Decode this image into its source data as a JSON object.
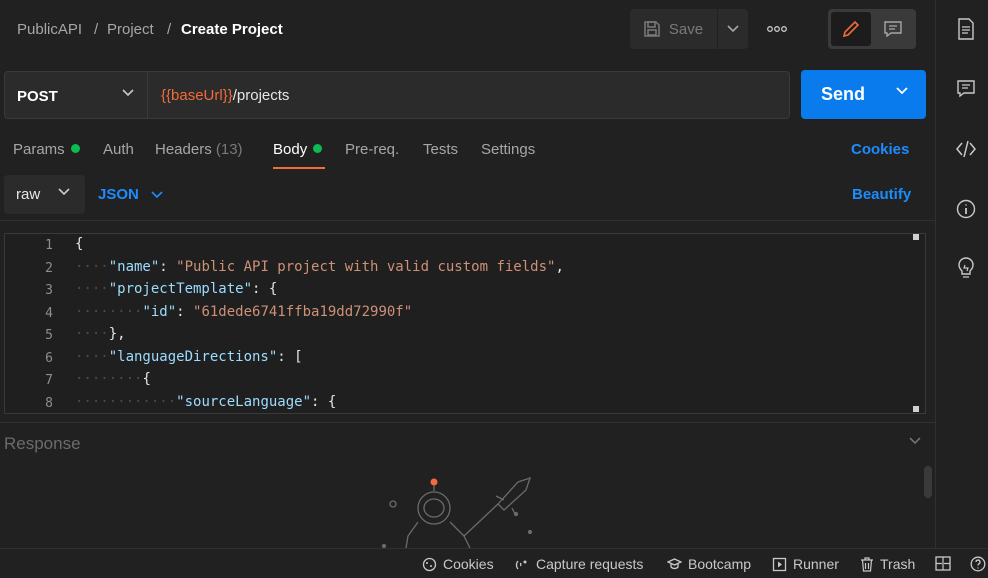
{
  "breadcrumb": {
    "items": [
      "PublicAPI",
      "Project"
    ],
    "sep": "/",
    "current": "Create Project"
  },
  "toolbar": {
    "save_label": "Save",
    "more_label": "ooo"
  },
  "request": {
    "method": "POST",
    "url_var": "{{baseUrl}}",
    "url_path": "/projects",
    "send_label": "Send"
  },
  "tabs": {
    "params": "Params",
    "auth": "Auth",
    "headers": "Headers",
    "headers_count": "(13)",
    "body": "Body",
    "prereq": "Pre-req.",
    "tests": "Tests",
    "settings": "Settings",
    "cookies_link": "Cookies"
  },
  "body_toolbar": {
    "mode": "raw",
    "format": "JSON",
    "beautify": "Beautify"
  },
  "editor": {
    "line_numbers": [
      "1",
      "2",
      "3",
      "4",
      "5",
      "6",
      "7",
      "8"
    ],
    "lines": [
      {
        "indent": 0,
        "parts": [
          {
            "t": "p",
            "v": "{"
          }
        ]
      },
      {
        "indent": 1,
        "parts": [
          {
            "t": "k",
            "v": "\"name\""
          },
          {
            "t": "p",
            "v": ": "
          },
          {
            "t": "s",
            "v": "\"Public API project with valid custom fields\""
          },
          {
            "t": "p",
            "v": ","
          }
        ]
      },
      {
        "indent": 1,
        "parts": [
          {
            "t": "k",
            "v": "\"projectTemplate\""
          },
          {
            "t": "p",
            "v": ": {"
          }
        ]
      },
      {
        "indent": 2,
        "parts": [
          {
            "t": "k",
            "v": "\"id\""
          },
          {
            "t": "p",
            "v": ": "
          },
          {
            "t": "s",
            "v": "\"61dede6741ffba19dd72990f\""
          }
        ]
      },
      {
        "indent": 1,
        "parts": [
          {
            "t": "p",
            "v": "},"
          }
        ]
      },
      {
        "indent": 1,
        "parts": [
          {
            "t": "k",
            "v": "\"languageDirections\""
          },
          {
            "t": "p",
            "v": ": ["
          }
        ]
      },
      {
        "indent": 2,
        "parts": [
          {
            "t": "p",
            "v": "{"
          }
        ]
      },
      {
        "indent": 3,
        "parts": [
          {
            "t": "k",
            "v": "\"sourceLanguage\""
          },
          {
            "t": "p",
            "v": ": {"
          }
        ]
      }
    ]
  },
  "response": {
    "label": "Response"
  },
  "statusbar": {
    "cookies": "Cookies",
    "capture": "Capture requests",
    "bootcamp": "Bootcamp",
    "runner": "Runner",
    "trash": "Trash"
  },
  "colors": {
    "accent": "#097bed",
    "link": "#1c8cff",
    "variable": "#f26b3a",
    "active_dot": "#0cbb52"
  }
}
